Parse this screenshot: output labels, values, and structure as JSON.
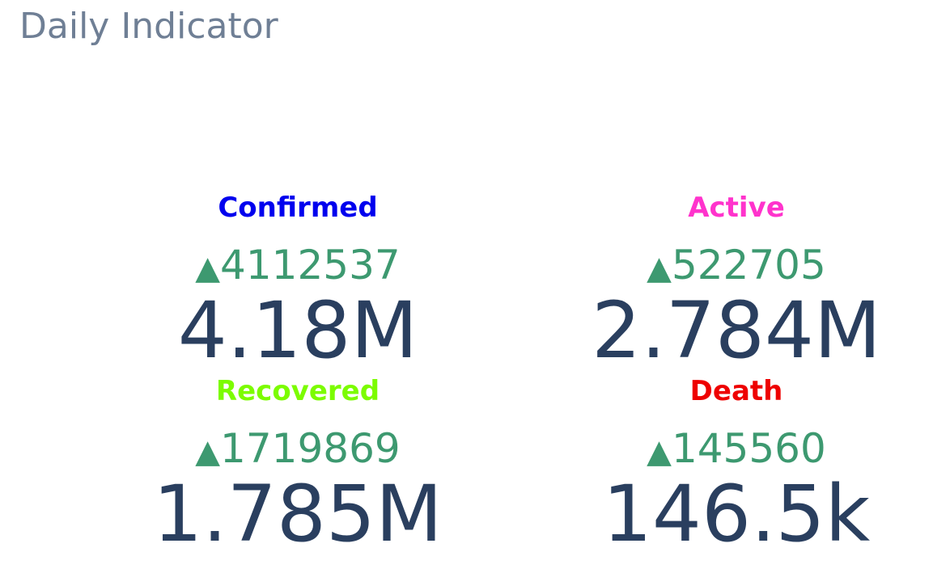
{
  "header": {
    "title": "Daily Indicator"
  },
  "colors": {
    "title": "#6f7f95",
    "value": "#2a3f5f",
    "delta_increasing": "#3d9970"
  },
  "chart_data": [
    {
      "type": "indicator",
      "title": "Confirmed",
      "title_color": "#0000ee",
      "value": 4180000,
      "value_text": "4.18M",
      "delta": 4112537,
      "delta_text": "4112537",
      "delta_direction": "increasing",
      "delta_symbol": "▲"
    },
    {
      "type": "indicator",
      "title": "Active",
      "title_color": "#ff33cc",
      "value": 2784000,
      "value_text": "2.784M",
      "delta": 522705,
      "delta_text": "522705",
      "delta_direction": "increasing",
      "delta_symbol": "▲"
    },
    {
      "type": "indicator",
      "title": "Recovered",
      "title_color": "#7cfc00",
      "value": 1785000,
      "value_text": "1.785M",
      "delta": 1719869,
      "delta_text": "1719869",
      "delta_direction": "increasing",
      "delta_symbol": "▲"
    },
    {
      "type": "indicator",
      "title": "Death",
      "title_color": "#ee0000",
      "value": 146500,
      "value_text": "146.5k",
      "delta": 145560,
      "delta_text": "145560",
      "delta_direction": "increasing",
      "delta_symbol": "▲"
    }
  ]
}
